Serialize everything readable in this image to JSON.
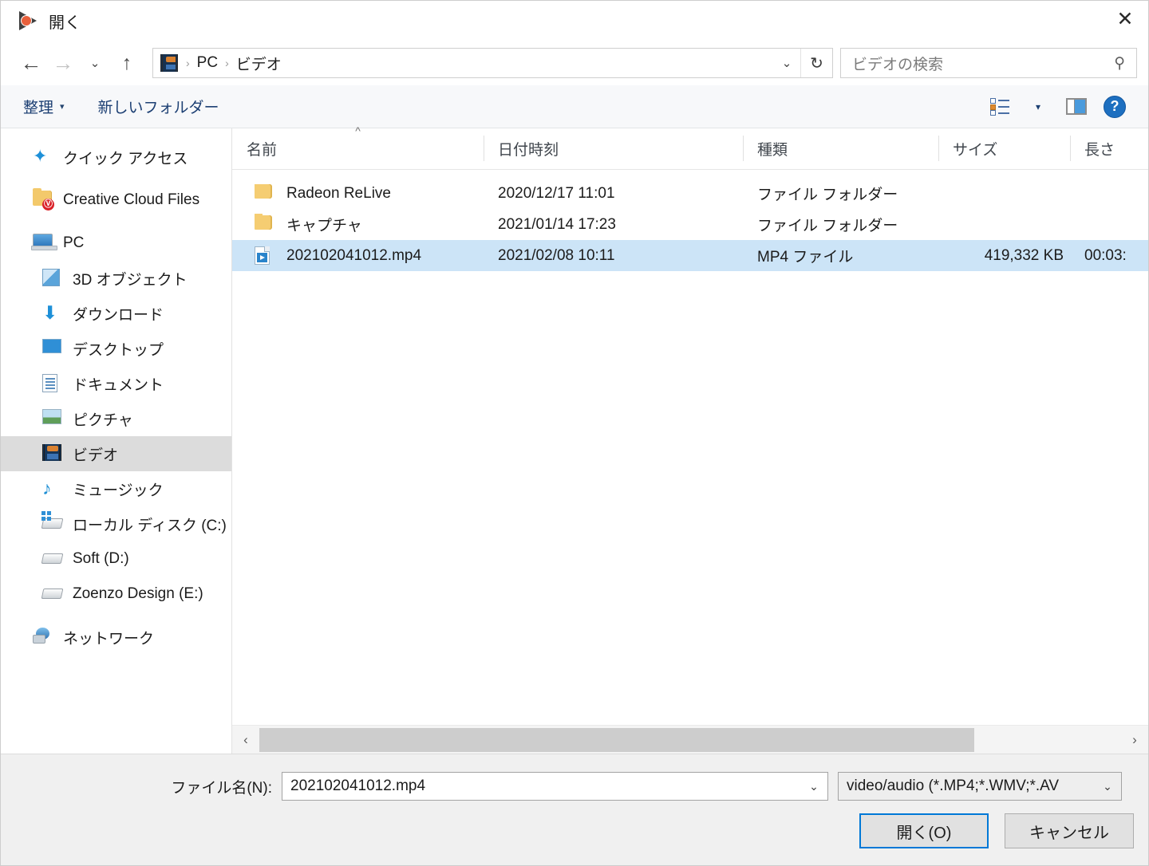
{
  "window": {
    "title": "開く",
    "app_icon": "media-player-icon",
    "close_label": "✕"
  },
  "nav": {
    "back_icon": "←",
    "forward_icon": "→",
    "history_icon": "⌄",
    "up_icon": "↑",
    "address": {
      "icon": "videos-folder-icon",
      "crumbs": [
        "PC",
        "ビデオ"
      ],
      "separator": "›",
      "dropdown_icon": "⌄",
      "refresh_icon": "↻"
    },
    "search": {
      "placeholder": "ビデオの検索",
      "icon": "search-icon"
    }
  },
  "toolbar": {
    "organize_label": "整理",
    "organize_caret": "▾",
    "new_folder_label": "新しいフォルダー",
    "view_caret": "▾",
    "help_label": "?"
  },
  "sidebar": {
    "items": [
      {
        "label": "クイック アクセス",
        "icon": "star-icon",
        "indent": false,
        "selected": false,
        "gap_before": false
      },
      {
        "label": "Creative Cloud Files",
        "icon": "creative-cloud-folder-icon",
        "indent": false,
        "selected": false,
        "gap_before": true
      },
      {
        "label": "PC",
        "icon": "pc-icon",
        "indent": false,
        "selected": false,
        "gap_before": true
      },
      {
        "label": "3D オブジェクト",
        "icon": "cube-icon",
        "indent": true,
        "selected": false,
        "gap_before": false
      },
      {
        "label": "ダウンロード",
        "icon": "download-icon",
        "indent": true,
        "selected": false,
        "gap_before": false
      },
      {
        "label": "デスクトップ",
        "icon": "desktop-icon",
        "indent": true,
        "selected": false,
        "gap_before": false
      },
      {
        "label": "ドキュメント",
        "icon": "documents-icon",
        "indent": true,
        "selected": false,
        "gap_before": false
      },
      {
        "label": "ピクチャ",
        "icon": "pictures-icon",
        "indent": true,
        "selected": false,
        "gap_before": false
      },
      {
        "label": "ビデオ",
        "icon": "videos-icon",
        "indent": true,
        "selected": true,
        "gap_before": false
      },
      {
        "label": "ミュージック",
        "icon": "music-icon",
        "indent": true,
        "selected": false,
        "gap_before": false
      },
      {
        "label": "ローカル ディスク (C:)",
        "icon": "local-disk-icon",
        "indent": true,
        "selected": false,
        "gap_before": false
      },
      {
        "label": "Soft (D:)",
        "icon": "drive-icon",
        "indent": true,
        "selected": false,
        "gap_before": false
      },
      {
        "label": "Zoenzo Design (E:)",
        "icon": "drive-icon",
        "indent": true,
        "selected": false,
        "gap_before": false
      },
      {
        "label": "ネットワーク",
        "icon": "network-icon",
        "indent": false,
        "selected": false,
        "gap_before": true
      }
    ]
  },
  "filelist": {
    "columns": [
      "名前",
      "日付時刻",
      "種類",
      "サイズ",
      "長さ"
    ],
    "sort_column": "名前",
    "sort_caret": "^",
    "rows": [
      {
        "name": "Radeon ReLive",
        "date": "2020/12/17 11:01",
        "type": "ファイル フォルダー",
        "size": "",
        "length": "",
        "icon": "folder-icon",
        "selected": false
      },
      {
        "name": "キャプチャ",
        "date": "2021/01/14 17:23",
        "type": "ファイル フォルダー",
        "size": "",
        "length": "",
        "icon": "folder-icon",
        "selected": false
      },
      {
        "name": "202102041012.mp4",
        "date": "2021/02/08 10:11",
        "type": "MP4 ファイル",
        "size": "419,332 KB",
        "length": "00:03:",
        "icon": "mp4-file-icon",
        "selected": true
      }
    ],
    "scroll": {
      "left_arrow": "‹",
      "right_arrow": "›"
    }
  },
  "footer": {
    "filename_label": "ファイル名(N):",
    "filename_value": "202102041012.mp4",
    "filename_caret": "⌄",
    "filter_value": "video/audio (*.MP4;*.WMV;*.AV",
    "filter_caret": "⌄",
    "open_label": "開く(O)",
    "cancel_label": "キャンセル"
  },
  "colors": {
    "selection_blue": "#cce4f7",
    "sidebar_selection": "#dcdcdc",
    "focus_border": "#0078d7",
    "toolbar_link": "#1c3f73"
  }
}
